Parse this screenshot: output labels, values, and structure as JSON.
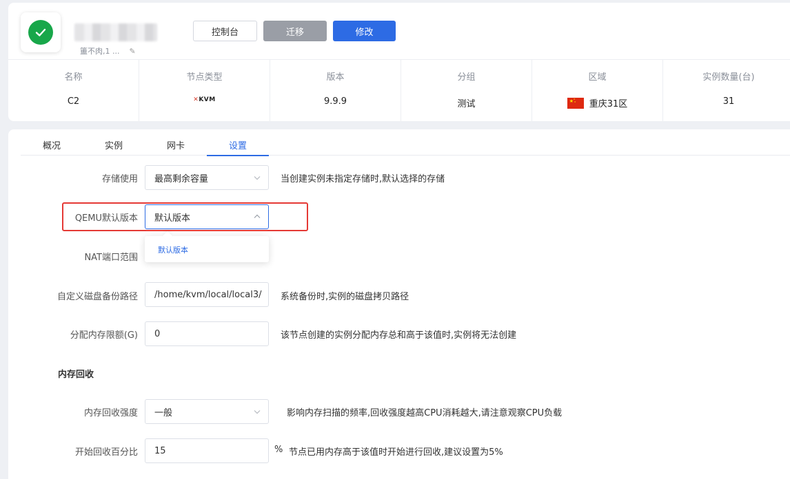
{
  "node": {
    "subtitle": "簠不肉,1 ...",
    "buttons": {
      "console": "控制台",
      "migrate": "迁移",
      "modify": "修改"
    }
  },
  "info": {
    "columns": [
      {
        "header": "名称",
        "value": "C2"
      },
      {
        "header": "节点类型",
        "value": "KVM"
      },
      {
        "header": "版本",
        "value": "9.9.9"
      },
      {
        "header": "分组",
        "value": "测试"
      },
      {
        "header": "区域",
        "value": "重庆31区"
      },
      {
        "header": "实例数量(台)",
        "value": "31"
      }
    ]
  },
  "tabs": [
    "概况",
    "实例",
    "网卡",
    "设置"
  ],
  "active_tab": "设置",
  "settings": {
    "storage": {
      "label": "存储使用",
      "value": "最高剩余容量",
      "hint": "当创建实例未指定存储时,默认选择的存储"
    },
    "qemu": {
      "label": "QEMU默认版本",
      "value": "默认版本",
      "options": [
        "默认版本"
      ]
    },
    "nat": {
      "label": "NAT端口范围"
    },
    "backup_path": {
      "label": "自定义磁盘备份路径",
      "value": "/home/kvm/local/local3/",
      "hint": "系统备份时,实例的磁盘拷贝路径"
    },
    "mem_limit": {
      "label": "分配内存限额(G)",
      "value": "0",
      "hint": "该节点创建的实例分配内存总和高于该值时,实例将无法创建"
    },
    "section_title": "内存回收",
    "reclaim_strength": {
      "label": "内存回收强度",
      "value": "一般",
      "hint": "影响内存扫描的频率,回收强度越高CPU消耗越大,请注意观察CPU负载"
    },
    "reclaim_percent": {
      "label": "开始回收百分比",
      "value": "15",
      "unit": "%",
      "hint": "节点已用内存高于该值时开始进行回收,建议设置为5%"
    }
  },
  "colors": {
    "primary": "#2d6be4",
    "success": "#18a74a",
    "highlight": "#e53935",
    "disabled": "#9a9ea6"
  }
}
